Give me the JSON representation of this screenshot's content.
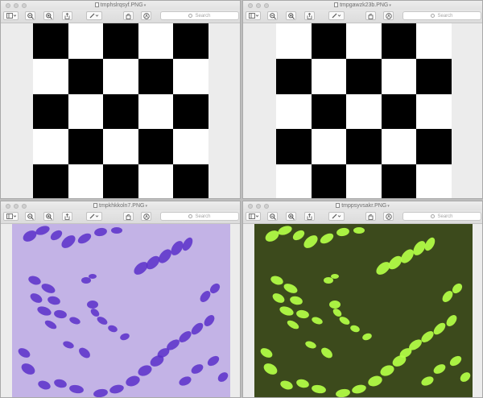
{
  "windows": [
    {
      "title": "tmphslrqsyf.PNG",
      "search_placeholder": "Search",
      "image": "checkerboard",
      "first_black": true
    },
    {
      "title": "tmpgawzk23b.PNG",
      "search_placeholder": "Search",
      "image": "checkerboard",
      "first_black": false
    },
    {
      "title": "tmpkhkkoln7.PNG",
      "search_placeholder": "Search",
      "image": "histology-purple"
    },
    {
      "title": "tmppsyvsakr.PNG",
      "search_placeholder": "Search",
      "image": "histology-green"
    }
  ],
  "colors": {
    "checker_dark": "#000000",
    "checker_light": "#ffffff",
    "stain_bg": "#c3b3e6",
    "stain_nucleus": "#5b2fc9",
    "fluor_bg": "#3c4a1c",
    "fluor_nucleus": "#b4ff46"
  }
}
